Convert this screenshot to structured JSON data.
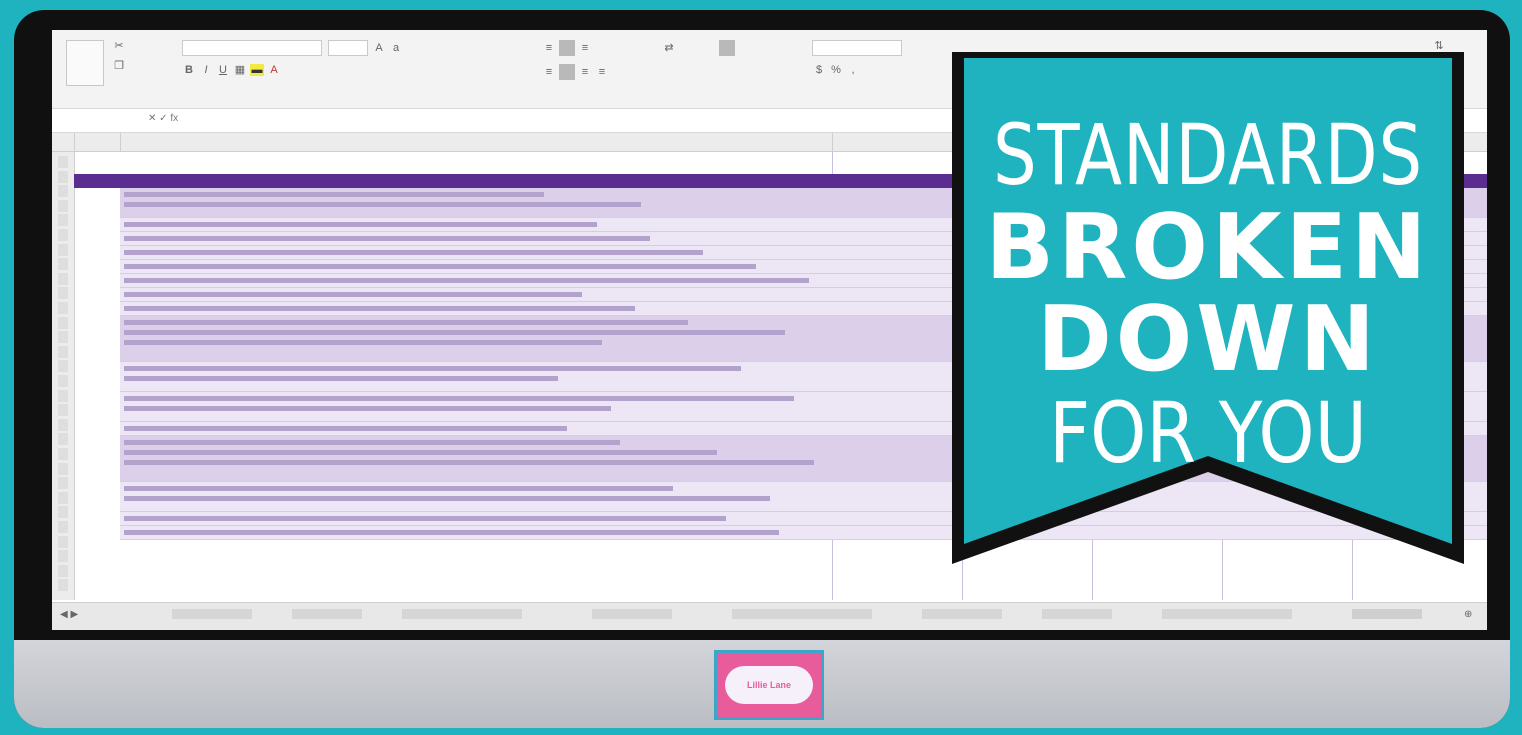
{
  "banner": {
    "line1": "STANDARDS",
    "line2": "BROKEN",
    "line3": "DOWN",
    "line4": "FOR YOU",
    "colors": {
      "fill": "#1fb3bf",
      "outline": "#111111",
      "text": "#ffffff"
    }
  },
  "logo": {
    "text": "Lillie Lane"
  },
  "colors": {
    "background": "#1fb3bf",
    "header_bar": "#5a2d91",
    "row_dark": "#dccfe9",
    "row_light": "#ede6f4"
  },
  "icons": [
    "paste-icon",
    "bold-icon",
    "italic-icon",
    "underline-icon",
    "highlight-icon",
    "font-color-icon"
  ]
}
